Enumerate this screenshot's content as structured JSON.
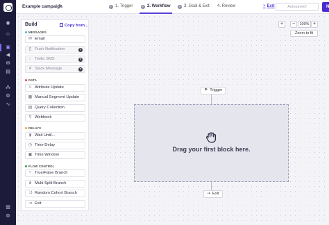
{
  "header": {
    "campaign_name": "Example campaign",
    "steps": [
      {
        "label": "1. Trigger",
        "done": true
      },
      {
        "label": "2. Workflow",
        "done": true,
        "active": true
      },
      {
        "label": "3. Goal & Exit",
        "done": true
      },
      {
        "label": "4. Review",
        "done": false
      }
    ],
    "exit_label": "Exit",
    "autosave_label": "Autosaved!",
    "next_label": "Next"
  },
  "nav": {
    "icons": [
      "dashboard-icon",
      "people-icon",
      "campaigns-icon",
      "broadcast-icon",
      "messages-icon",
      "objects-icon",
      "integrations-icon",
      "settings-icon",
      "activity-icon",
      "docs-icon",
      "account-icon"
    ]
  },
  "build": {
    "title": "Build",
    "copy_from_label": "Copy from...",
    "sections": [
      {
        "label": "MESSAGES",
        "color": "#3dbcd6",
        "items": [
          {
            "label": "Email",
            "icon": "mail-icon",
            "disabled": false,
            "info": false
          },
          {
            "label": "Push Notification",
            "icon": "phone-icon",
            "disabled": true,
            "info": true
          },
          {
            "label": "Twilio SMS",
            "icon": "sms-icon",
            "disabled": true,
            "info": true
          },
          {
            "label": "Slack Message",
            "icon": "slack-icon",
            "disabled": true,
            "info": true
          }
        ]
      },
      {
        "label": "DATA",
        "color": "#e5484d",
        "items": [
          {
            "label": "Attribute Update",
            "icon": "attribute-icon"
          },
          {
            "label": "Manual Segment Update",
            "icon": "segment-icon"
          },
          {
            "label": "Query Collection",
            "icon": "database-icon"
          },
          {
            "label": "Webhook",
            "icon": "webhook-icon"
          }
        ]
      },
      {
        "label": "DELAYS",
        "color": "#f5a623",
        "items": [
          {
            "label": "Wait Until...",
            "icon": "hourglass-icon"
          },
          {
            "label": "Time Delay",
            "icon": "clock-icon"
          },
          {
            "label": "Time Window",
            "icon": "calendar-icon"
          }
        ]
      },
      {
        "label": "FLOW CONTROL",
        "color": "#2f9e44",
        "items": [
          {
            "label": "True/False Branch",
            "icon": "branch-icon"
          },
          {
            "label": "Multi-Split Branch",
            "icon": "split-icon"
          },
          {
            "label": "Random Cohort Branch",
            "icon": "shuffle-icon"
          },
          {
            "label": "Exit",
            "icon": "exit-icon"
          }
        ]
      }
    ]
  },
  "canvas": {
    "trigger_label": "Trigger",
    "exit_label": "Exit",
    "drop_text": "Drag your first block here.",
    "zoom_level": "100%",
    "zoom_fit_label": "Zoom to fit",
    "zoom_in": "+",
    "zoom_out": "−"
  }
}
